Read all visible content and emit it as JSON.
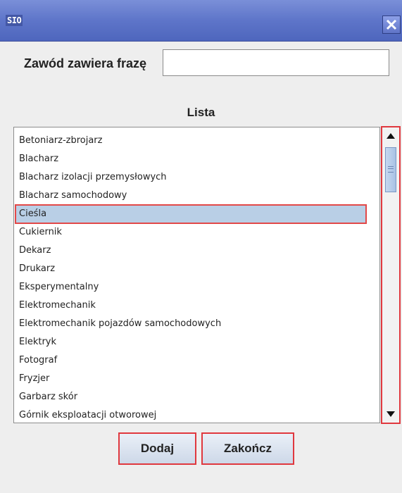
{
  "window": {
    "app_logo_text": "SIO",
    "close_icon": "close-icon"
  },
  "search": {
    "label": "Zawód zawiera frazę",
    "value": "",
    "placeholder": ""
  },
  "list": {
    "heading": "Lista",
    "items": [
      "Betoniarz-zbrojarz",
      "Blacharz",
      "Blacharz izolacji przemysłowych",
      "Blacharz samochodowy",
      "Cieśla",
      "Cukiernik",
      "Dekarz",
      "Drukarz",
      "Eksperymentalny",
      "Elektromechanik",
      "Elektromechanik pojazdów samochodowych",
      "Elektryk",
      "Fotograf",
      "Fryzjer",
      "Garbarz skór",
      "Górnik eksploatacji otworowej"
    ],
    "selected_item": "Cieśla"
  },
  "buttons": {
    "add_label": "Dodaj",
    "close_label": "Zakończ"
  },
  "colors": {
    "titlebar": "#5e75c9",
    "selection": "#b9cfe6",
    "highlight_border": "#e0383e"
  }
}
